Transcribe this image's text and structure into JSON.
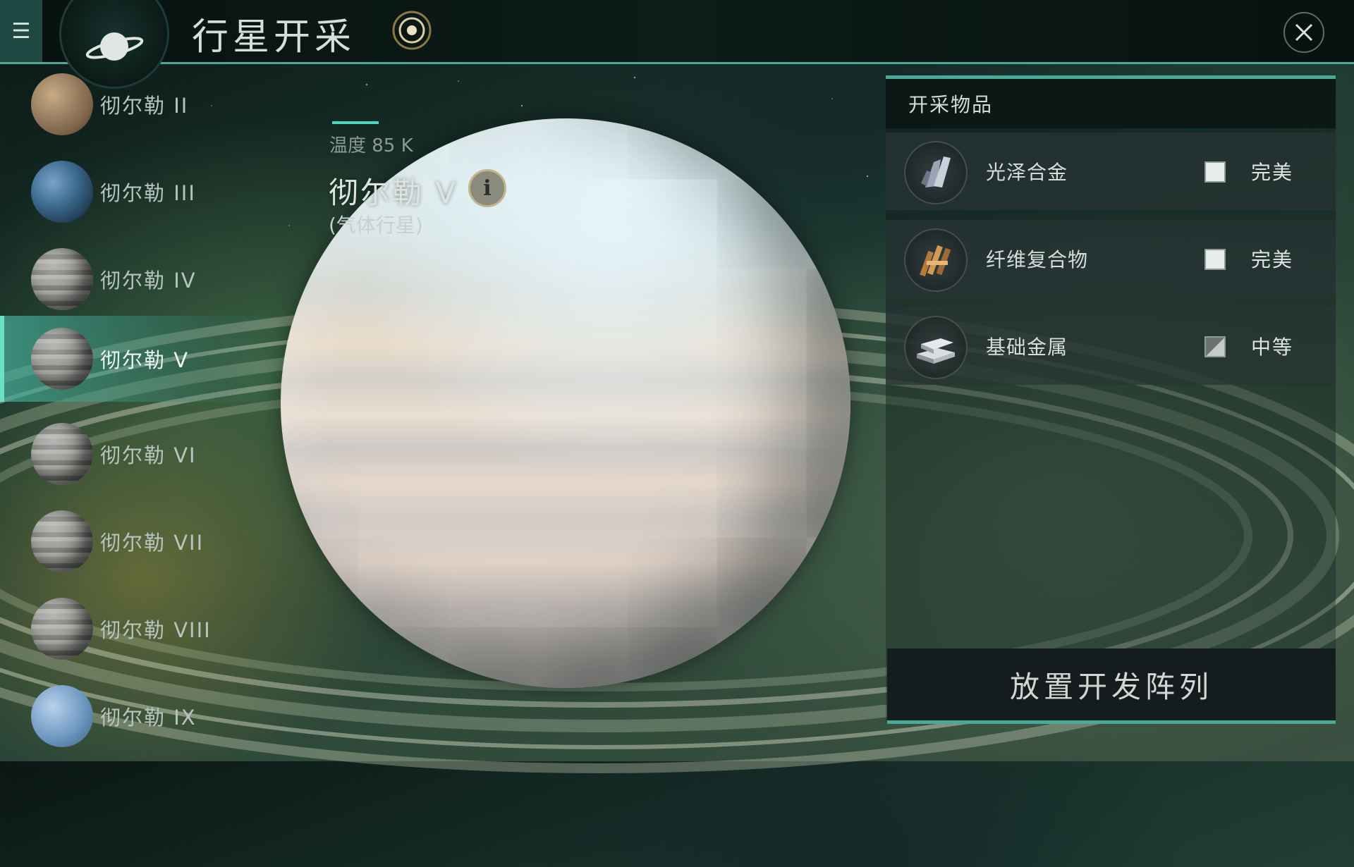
{
  "header": {
    "title": "行星开采",
    "menu_icon": "menu-icon",
    "planet_icon": "planet-icon",
    "target_icon": "target-icon",
    "close_icon": "close-icon"
  },
  "sidebar": {
    "items": [
      {
        "label": "彻尔勒 II",
        "thumb": "rocky",
        "selected": false
      },
      {
        "label": "彻尔勒 III",
        "thumb": "earth-like",
        "selected": false
      },
      {
        "label": "彻尔勒 IV",
        "thumb": "gas",
        "selected": false
      },
      {
        "label": "彻尔勒 V",
        "thumb": "gas",
        "selected": true
      },
      {
        "label": "彻尔勒 VI",
        "thumb": "gas",
        "selected": false
      },
      {
        "label": "彻尔勒 VII",
        "thumb": "gas",
        "selected": false
      },
      {
        "label": "彻尔勒 VIII",
        "thumb": "gas",
        "selected": false
      },
      {
        "label": "彻尔勒 IX",
        "thumb": "ice",
        "selected": false
      }
    ]
  },
  "planet": {
    "temperature": "温度 85 K",
    "name": "彻尔勒 V",
    "type": "(气体行星)",
    "info_icon": "info-icon"
  },
  "panel": {
    "title": "开采物品",
    "resources": [
      {
        "name": "光泽合金",
        "grade": "完美",
        "icon": "alloy-crystal-icon",
        "check": "full"
      },
      {
        "name": "纤维复合物",
        "grade": "完美",
        "icon": "fiber-composite-icon",
        "check": "full"
      },
      {
        "name": "基础金属",
        "grade": "中等",
        "icon": "metal-ingot-icon",
        "check": "partial"
      }
    ]
  },
  "deploy_button": "放置开发阵列",
  "colors": {
    "accent": "#4aa899",
    "selected_highlight": "#46aa96",
    "panel_bg": "#283434"
  }
}
